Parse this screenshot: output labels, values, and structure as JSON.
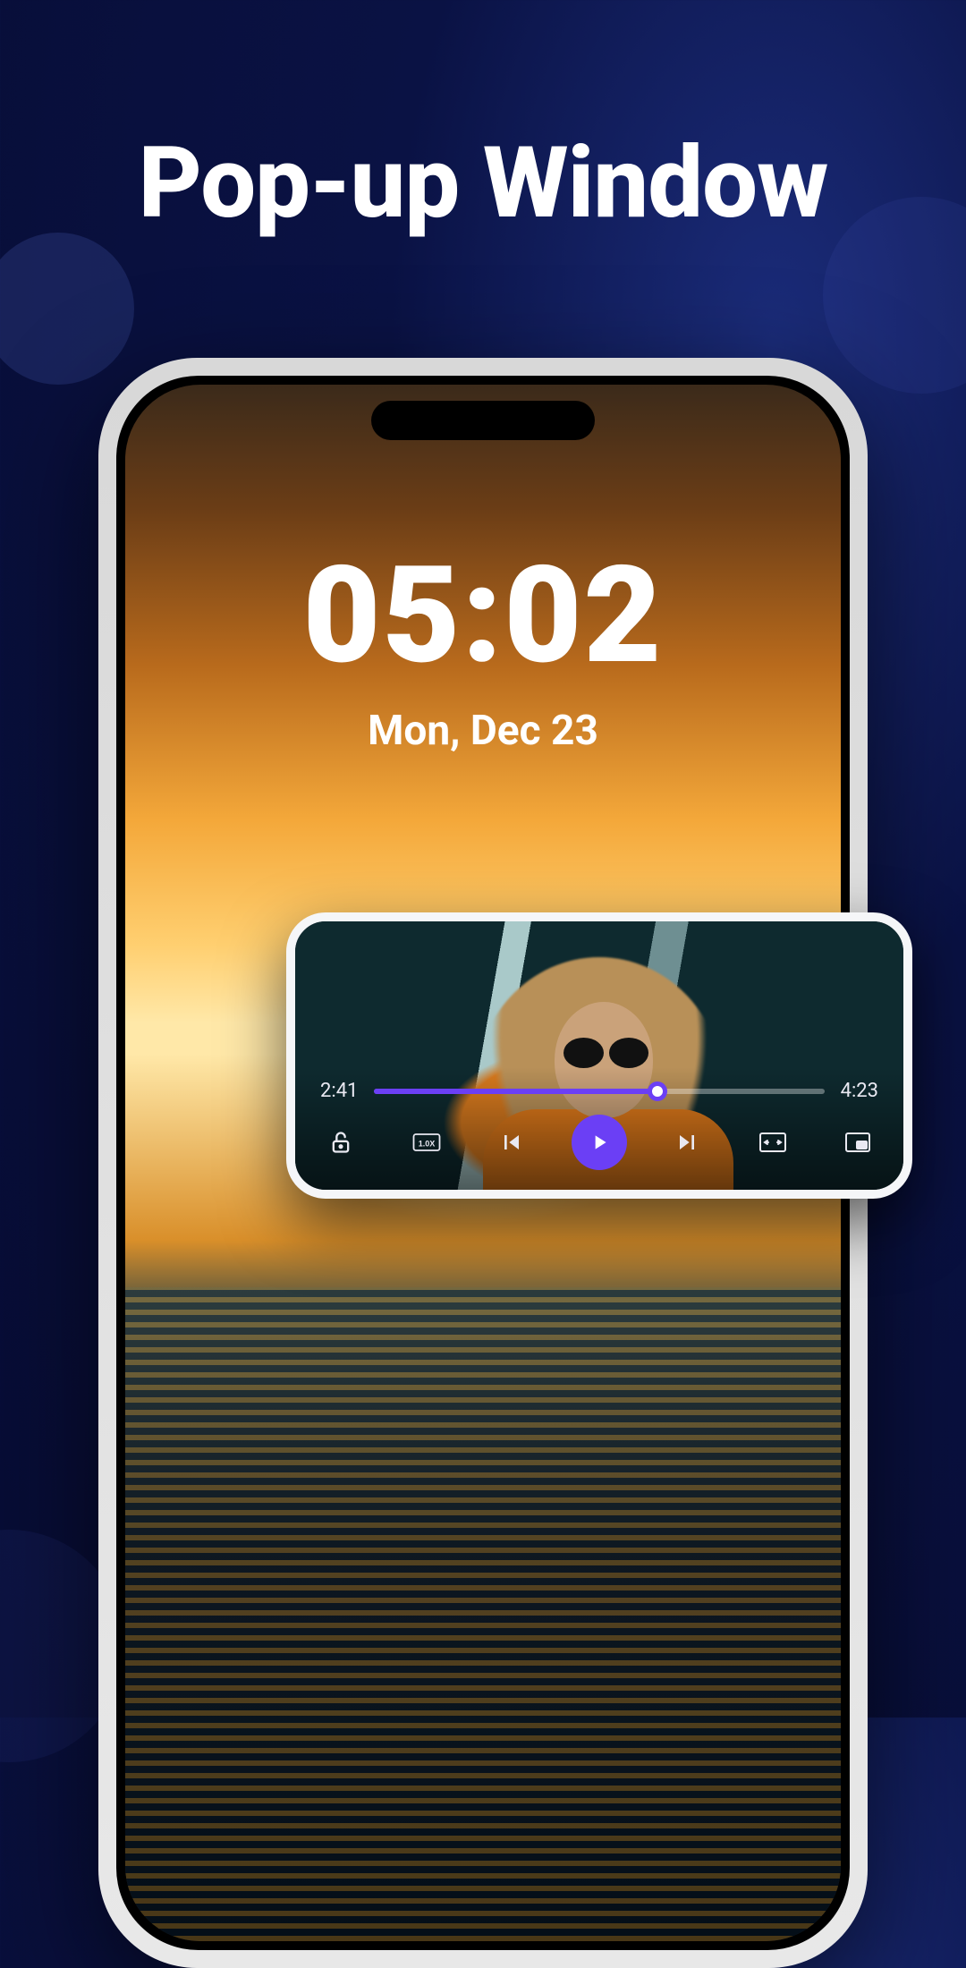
{
  "headline": "Pop-up Window",
  "lockscreen": {
    "time": "05:02",
    "date": "Mon, Dec 23"
  },
  "player": {
    "elapsed": "2:41",
    "duration": "4:23",
    "progress_percent": 63,
    "speed_label": "1.0X",
    "icons": {
      "lock": "lock-icon",
      "speed": "speed-icon",
      "previous": "skip-previous-icon",
      "play": "play-icon",
      "next": "skip-next-icon",
      "aspect": "aspect-ratio-icon",
      "pip": "picture-in-picture-icon"
    }
  },
  "colors": {
    "accent": "#6b3ff5",
    "bg_deep": "#070c33"
  }
}
